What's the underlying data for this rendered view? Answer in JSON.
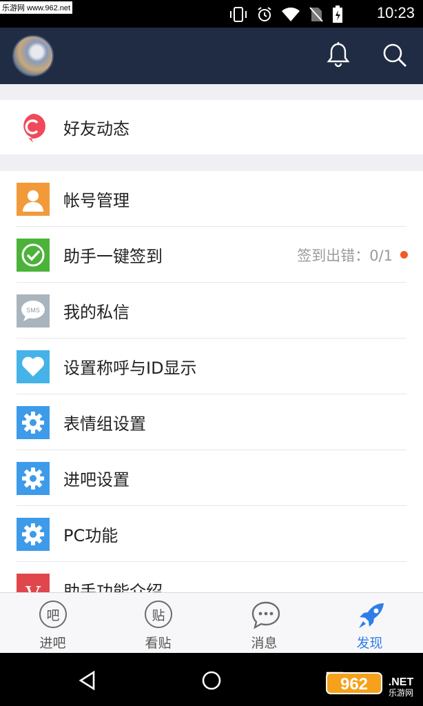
{
  "status_bar": {
    "watermark": "乐游网 www.962.net",
    "time": "10:23"
  },
  "header": {
    "icons": [
      "avatar",
      "bell-icon",
      "search-icon"
    ]
  },
  "top_section": {
    "item": {
      "label": "好友动态",
      "icon": "friend-feed-icon",
      "color": "#f04a5a"
    }
  },
  "menu": {
    "items": [
      {
        "label": "帐号管理",
        "icon": "account-icon",
        "color": "#f29a3a"
      },
      {
        "label": "助手一键签到",
        "icon": "checkin-icon",
        "color": "#4cb23a",
        "status": "签到出错：0/1"
      },
      {
        "label": "我的私信",
        "icon": "sms-icon",
        "color": "#aab4bd",
        "icon_text": "SMS"
      },
      {
        "label": "设置称呼与ID显示",
        "icon": "heart-icon",
        "color": "#45b3e7"
      },
      {
        "label": "表情组设置",
        "icon": "gear-icon",
        "color": "#3d9be9"
      },
      {
        "label": "进吧设置",
        "icon": "gear-icon",
        "color": "#3d9be9"
      },
      {
        "label": "PC功能",
        "icon": "gear-icon",
        "color": "#3d9be9"
      },
      {
        "label": "助手功能介绍",
        "icon": "v-icon",
        "color": "#e0474c",
        "icon_text": "V"
      }
    ]
  },
  "tabs": [
    {
      "label": "进吧",
      "glyph": "吧",
      "active": false
    },
    {
      "label": "看贴",
      "glyph": "贴",
      "active": false
    },
    {
      "label": "消息",
      "glyph": "···",
      "active": false
    },
    {
      "label": "发现",
      "glyph": "",
      "active": true
    }
  ],
  "watermark_bottom": "962.NET 乐游网",
  "colors": {
    "header": "#1f2c43",
    "accent": "#2f7ee8",
    "alert_dot": "#f05a28"
  }
}
